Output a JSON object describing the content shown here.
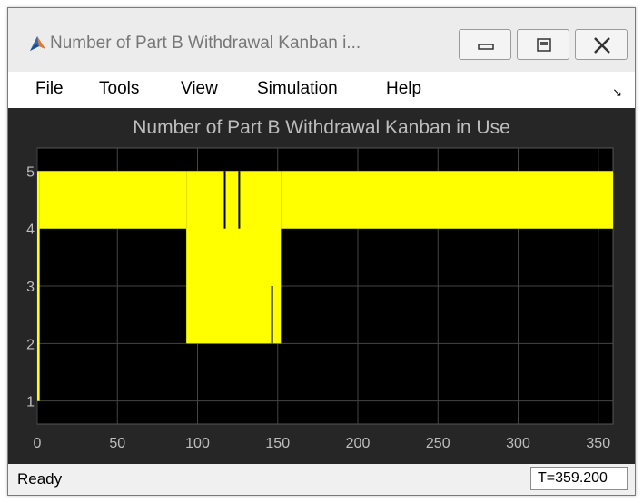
{
  "window": {
    "title": "Number of Part B Withdrawal Kanban i...",
    "icon": "matlab-logo-icon",
    "buttons": [
      "minimize",
      "maximize",
      "close"
    ]
  },
  "menu": {
    "items": [
      "File",
      "Tools",
      "View",
      "Simulation",
      "Help"
    ],
    "undock_icon": "undock-arrow-icon",
    "undock_glyph": "↘"
  },
  "chart_data": {
    "type": "line",
    "title": "Number of Part B Withdrawal Kanban in Use",
    "xlabel": "",
    "ylabel": "",
    "xlim": [
      0,
      359.2
    ],
    "ylim": [
      0.6,
      5.4
    ],
    "xticks": [
      "0",
      "50",
      "100",
      "150",
      "200",
      "250",
      "300",
      "350"
    ],
    "yticks": [
      "1",
      "2",
      "3",
      "4",
      "5"
    ],
    "grid": true,
    "background": "#000000",
    "axes_color": "#262626",
    "grid_color": "#444444",
    "series": [
      {
        "color": "#ffff00",
        "bands": [
          {
            "x": [
              0,
              1.5
            ],
            "low": 1,
            "high": 5
          },
          {
            "x": [
              1.5,
              93
            ],
            "low": 4,
            "high": 5
          },
          {
            "x": [
              93,
              152
            ],
            "low": 2,
            "high": 5
          },
          {
            "x": [
              152,
              359.2
            ],
            "low": 4,
            "high": 5
          }
        ],
        "dips": [
          {
            "x": 117,
            "low": 4,
            "high": 5
          },
          {
            "x": 126,
            "low": 4,
            "high": 5
          },
          {
            "x": 146.5,
            "low": 2,
            "high": 3
          }
        ]
      }
    ]
  },
  "status": {
    "text": "Ready",
    "time": "T=359.200"
  }
}
